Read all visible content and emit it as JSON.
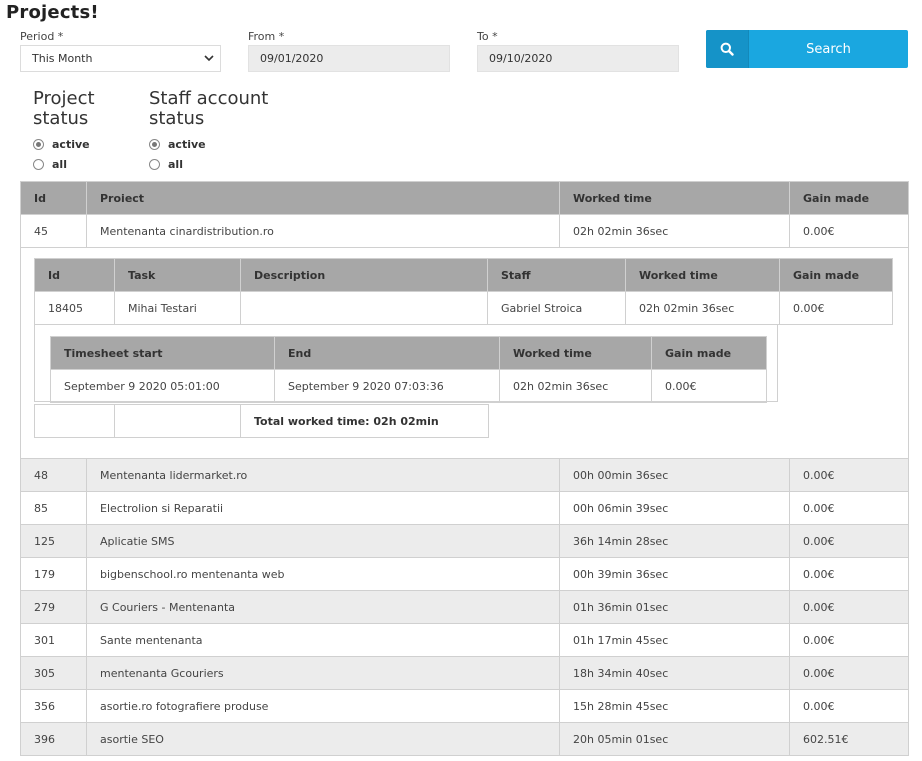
{
  "page": {
    "title": "Projects!"
  },
  "filters": {
    "period_label": "Period *",
    "period_value": "This Month",
    "from_label": "From *",
    "from_value": "09/01/2020",
    "to_label": "To *",
    "to_value": "09/10/2020",
    "search_label": "Search"
  },
  "project_status": {
    "title": "Project status",
    "options": [
      {
        "label": "active",
        "checked": true
      },
      {
        "label": "all",
        "checked": false
      }
    ]
  },
  "staff_status": {
    "title": "Staff account status",
    "options": [
      {
        "label": "active",
        "checked": true
      },
      {
        "label": "all",
        "checked": false
      }
    ]
  },
  "projects_table": {
    "headers": [
      "Id",
      "Proiect",
      "Worked time",
      "Gain made"
    ],
    "expanded_row": {
      "id": "45",
      "project": "Mentenanta cinardistribution.ro",
      "worked": "02h 02min 36sec",
      "gain": "0.00€"
    },
    "rows": [
      {
        "id": "48",
        "project": "Mentenanta lidermarket.ro",
        "worked": "00h 00min 36sec",
        "gain": "0.00€"
      },
      {
        "id": "85",
        "project": "Electrolion si Reparatii",
        "worked": "00h 06min 39sec",
        "gain": "0.00€"
      },
      {
        "id": "125",
        "project": "Aplicatie SMS",
        "worked": "36h 14min 28sec",
        "gain": "0.00€"
      },
      {
        "id": "179",
        "project": "bigbenschool.ro mentenanta web",
        "worked": "00h 39min 36sec",
        "gain": "0.00€"
      },
      {
        "id": "279",
        "project": "G Couriers - Mentenanta",
        "worked": "01h 36min 01sec",
        "gain": "0.00€"
      },
      {
        "id": "301",
        "project": "Sante mentenanta",
        "worked": "01h 17min 45sec",
        "gain": "0.00€"
      },
      {
        "id": "305",
        "project": "mentenanta Gcouriers",
        "worked": "18h 34min 40sec",
        "gain": "0.00€"
      },
      {
        "id": "356",
        "project": "asortie.ro fotografiere produse",
        "worked": "15h 28min 45sec",
        "gain": "0.00€"
      },
      {
        "id": "396",
        "project": "asortie SEO",
        "worked": "20h 05min 01sec",
        "gain": "602.51€"
      }
    ]
  },
  "task_table": {
    "headers": [
      "Id",
      "Task",
      "Description",
      "Staff",
      "Worked time",
      "Gain made"
    ],
    "row": {
      "id": "18405",
      "task": "Mihai Testari",
      "description": "",
      "staff": "Gabriel Stroica",
      "worked": "02h 02min 36sec",
      "gain": "0.00€"
    }
  },
  "timesheet_table": {
    "headers": [
      "Timesheet start",
      "End",
      "Worked time",
      "Gain made"
    ],
    "row": {
      "start": "September 9 2020 05:01:00",
      "end": "September 9 2020 07:03:36",
      "worked": "02h 02min 36sec",
      "gain": "0.00€"
    }
  },
  "total": {
    "label": "Total worked time: 02h 02min"
  },
  "icons": {
    "search": "search-icon",
    "dropdown": "chevron-down-icon"
  },
  "colors": {
    "accent": "#1aa7e0",
    "header_bg": "#a7a7a7",
    "alt_row": "#ececec"
  }
}
